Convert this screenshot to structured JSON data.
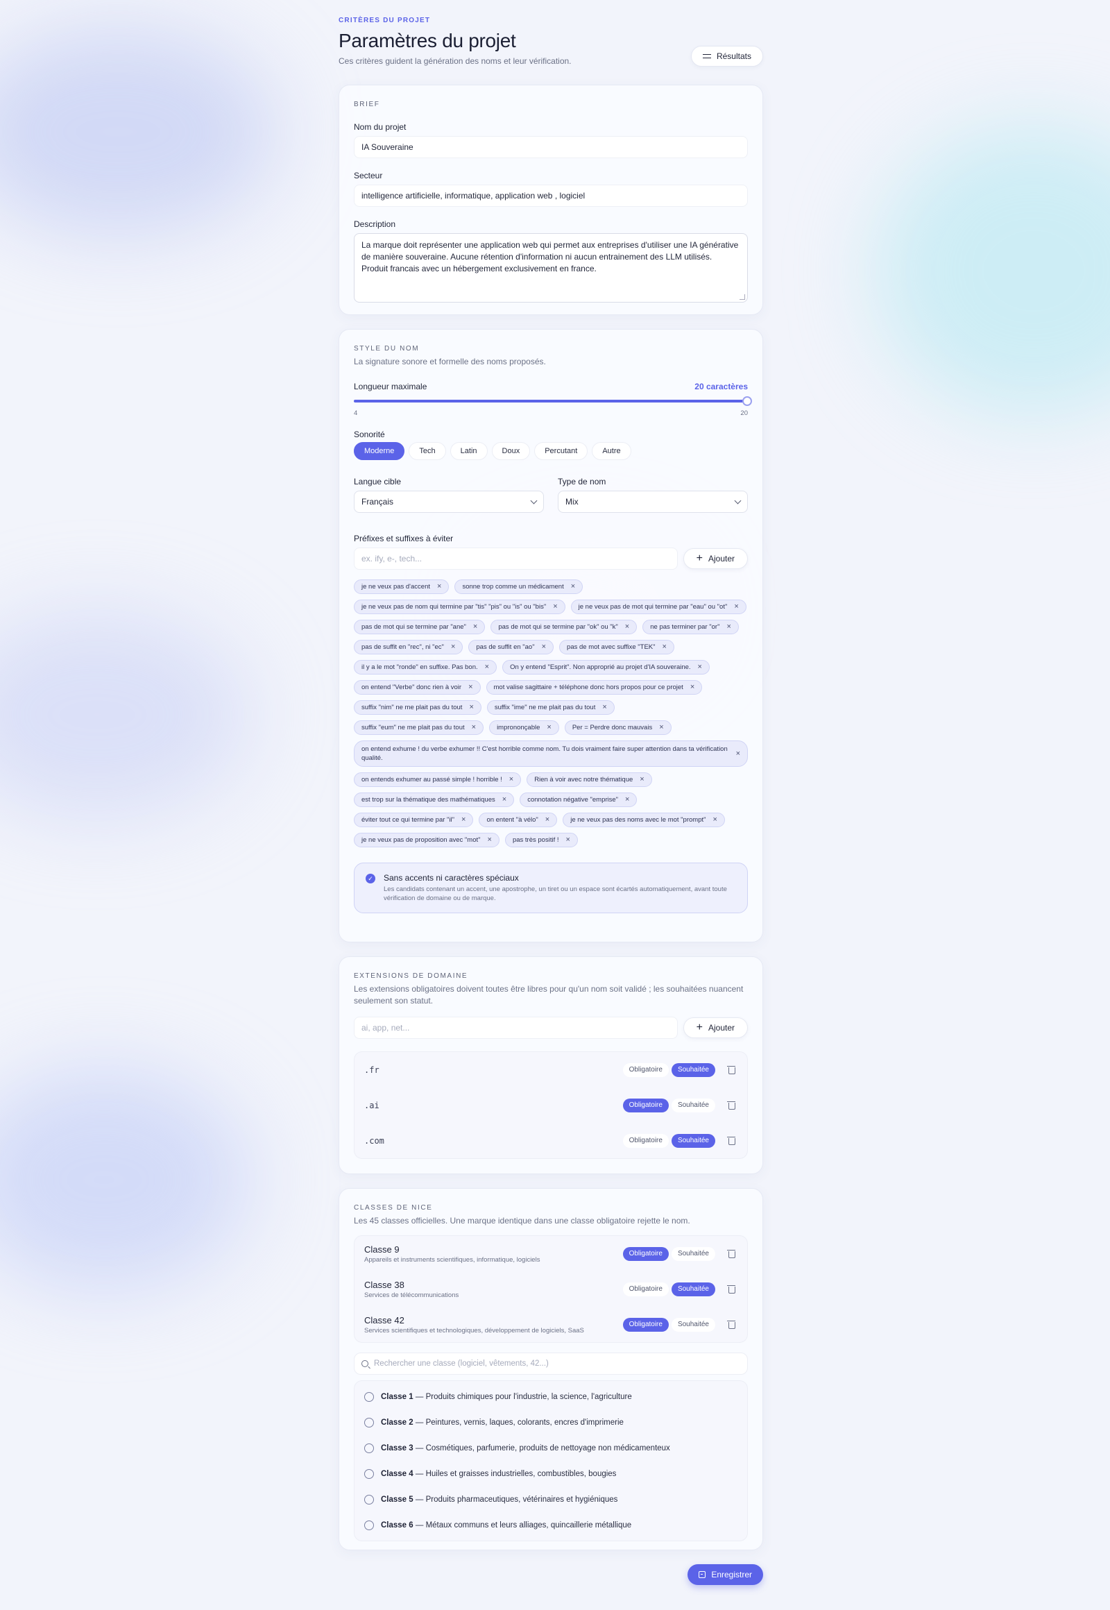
{
  "header": {
    "eyebrow": "CRITÈRES DU PROJET",
    "title": "Paramètres du projet",
    "subtitle": "Ces critères guident la génération des noms et leur vérification.",
    "results_label": "Résultats"
  },
  "brief": {
    "section_label": "BRIEF",
    "name_label": "Nom du projet",
    "name_value": "IA Souveraine",
    "sector_label": "Secteur",
    "sector_value": "intelligence artificielle, informatique, application web , logiciel",
    "description_label": "Description",
    "description_value": "La marque doit représenter une application web qui permet aux entreprises d'utiliser une IA générative de manière souveraine. Aucune rétention d'information ni aucun entrainement des LLM utilisés. Produit francais avec un hébergement exclusivement en france."
  },
  "style": {
    "section_label": "STYLE DU NOM",
    "description": "La signature sonore et formelle des noms proposés.",
    "length_label": "Longueur maximale",
    "length_value": "20 caractères",
    "length_level": 1.0,
    "slider_min": "4",
    "slider_max": "20",
    "sonority_label": "Sonorité",
    "sonority_options": [
      "Moderne",
      "Tech",
      "Latin",
      "Doux",
      "Percutant",
      "Autre"
    ],
    "sonority_selected": "Moderne",
    "language_label": "Langue cible",
    "language_value": "Français",
    "type_label": "Type de nom",
    "type_value": "Mix",
    "affix_label": "Préfixes et suffixes à éviter",
    "affix_placeholder": "ex. ify, e-, tech...",
    "add_label": "Ajouter",
    "tags": [
      "je ne veux pas d'accent",
      "sonne trop comme un médicament",
      "je ne veux pas de nom qui termine par \"tis\" \"pis\" ou \"is\" ou \"bis\"",
      "je ne veux pas de mot qui termine par \"eau\" ou \"ot\"",
      "pas de mot qui se termine par \"ane\"",
      "pas de mot qui se termine par \"ok\" ou \"k\"",
      "ne pas terminer par \"or\"",
      "pas de suffit en \"rec\", ni \"ec\"",
      "pas de suffit en \"ao\"",
      "pas de mot avec suffixe \"TEK\"",
      "il y a le mot \"ronde\" en suffixe. Pas bon.",
      "On y entend \"Esprit\". Non approprié au projet d'IA souveraine.",
      "on entend \"Verbe\" donc rien à voir",
      "mot valise sagittaire + téléphone donc hors propos pour ce projet",
      "suffix \"nim\" ne me plait pas du tout",
      "suffix \"ime\" ne me plait pas du tout",
      "suffix \"eum\" ne me plait pas du tout",
      "imprononçable",
      "Per = Perdre donc mauvais",
      "on entend exhume ! du verbe exhumer !! C'est horrible comme nom. Tu dois vraiment faire super attention dans ta vérification qualité.",
      "on entends exhumer au passé simple ! horrible !",
      "Rien à voir avec notre thématique",
      "est trop sur la thématique des mathématiques",
      "connotation négative \"emprise\"",
      "éviter tout ce qui termine par \"il\"",
      "on entent \"à vélo\"",
      "je ne veux pas des noms avec le mot \"prompt\"",
      "je ne veux pas de proposition avec \"mot\"",
      "pas très positif !"
    ],
    "no_accents_title": "Sans accents ni caractères spéciaux",
    "no_accents_desc": "Les candidats contenant un accent, une apostrophe, un tiret ou un espace sont écartés automatiquement, avant toute vérification de domaine ou de marque."
  },
  "domains": {
    "section_label": "EXTENSIONS DE DOMAINE",
    "description": "Les extensions obligatoires doivent toutes être libres pour qu'un nom soit validé ; les souhaitées nuancent seulement son statut.",
    "placeholder": "ai, app, net...",
    "add_label": "Ajouter",
    "required_label": "Obligatoire",
    "wanted_label": "Souhaitée",
    "items": [
      {
        "ext": ".fr",
        "status": "Souhaitée"
      },
      {
        "ext": ".ai",
        "status": "Obligatoire"
      },
      {
        "ext": ".com",
        "status": "Souhaitée"
      }
    ]
  },
  "nice": {
    "section_label": "CLASSES DE NICE",
    "description": "Les 45 classes officielles. Une marque identique dans une classe obligatoire rejette le nom.",
    "required_label": "Obligatoire",
    "wanted_label": "Souhaitée",
    "selected": [
      {
        "name": "Classe 9",
        "desc": "Appareils et instruments scientifiques, informatique, logiciels",
        "status": "Obligatoire"
      },
      {
        "name": "Classe 38",
        "desc": "Services de télécommunications",
        "status": "Souhaitée"
      },
      {
        "name": "Classe 42",
        "desc": "Services scientifiques et technologiques, développement de logiciels, SaaS",
        "status": "Obligatoire"
      }
    ],
    "search_placeholder": "Rechercher une classe (logiciel, vêtements, 42...)",
    "options": [
      {
        "name": "Classe 1",
        "desc": " — Produits chimiques pour l'industrie, la science, l'agriculture"
      },
      {
        "name": "Classe 2",
        "desc": " — Peintures, vernis, laques, colorants, encres d'imprimerie"
      },
      {
        "name": "Classe 3",
        "desc": " — Cosmétiques, parfumerie, produits de nettoyage non médicamenteux"
      },
      {
        "name": "Classe 4",
        "desc": " — Huiles et graisses industrielles, combustibles, bougies"
      },
      {
        "name": "Classe 5",
        "desc": " — Produits pharmaceutiques, vétérinaires et hygiéniques"
      },
      {
        "name": "Classe 6",
        "desc": " — Métaux communs et leurs alliages, quincaillerie métallique"
      }
    ]
  },
  "footer": {
    "save_label": "Enregistrer"
  }
}
